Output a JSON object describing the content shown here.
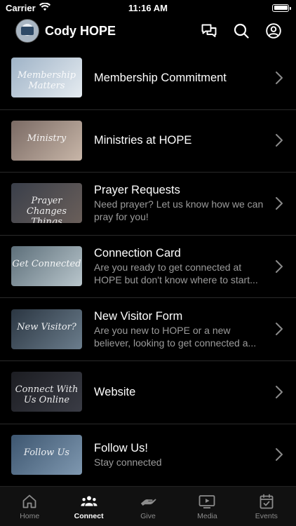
{
  "status_bar": {
    "carrier": "Carrier",
    "time": "11:16 AM"
  },
  "header": {
    "title": "Cody HOPE",
    "actions": [
      {
        "name": "chat-icon"
      },
      {
        "name": "search-icon"
      },
      {
        "name": "profile-icon"
      }
    ]
  },
  "list": {
    "items": [
      {
        "title": "Membership Commitment",
        "subtitle": "",
        "thumb_text": "Membership Matters",
        "thumb_colors": [
          "#9fb3c7",
          "#e6ecf1"
        ]
      },
      {
        "title": "Ministries at HOPE",
        "subtitle": "",
        "thumb_text": "Ministry",
        "thumb_colors": [
          "#7a6a64",
          "#c8b6a8"
        ]
      },
      {
        "title": "Prayer Requests",
        "subtitle": "Need prayer? Let us know how we can pray for you!",
        "thumb_text": "Prayer Changes Things",
        "thumb_colors": [
          "#3a3f4a",
          "#6a5f5a"
        ]
      },
      {
        "title": "Connection Card",
        "subtitle": "Are you ready to get connected at HOPE but don't know where to start...",
        "thumb_text": "Get Connected",
        "thumb_colors": [
          "#5d6f7a",
          "#b9c6cc"
        ]
      },
      {
        "title": "New Visitor Form",
        "subtitle": "Are you new to HOPE or a new believer, looking to get connected a...",
        "thumb_text": "New Visitor?",
        "thumb_colors": [
          "#2b3642",
          "#6b7d8c"
        ]
      },
      {
        "title": "Website",
        "subtitle": "",
        "thumb_text": "Connect With Us Online",
        "thumb_colors": [
          "#1c1d22",
          "#3a3c45"
        ]
      },
      {
        "title": "Follow Us!",
        "subtitle": "Stay connected",
        "thumb_text": "Follow Us",
        "thumb_colors": [
          "#3d5670",
          "#7f98b0"
        ]
      }
    ]
  },
  "tabbar": {
    "tabs": [
      {
        "label": "Home",
        "icon": "home-icon",
        "active": false
      },
      {
        "label": "Connect",
        "icon": "people-icon",
        "active": true
      },
      {
        "label": "Give",
        "icon": "give-icon",
        "active": false
      },
      {
        "label": "Media",
        "icon": "media-icon",
        "active": false
      },
      {
        "label": "Events",
        "icon": "calendar-icon",
        "active": false
      }
    ]
  }
}
